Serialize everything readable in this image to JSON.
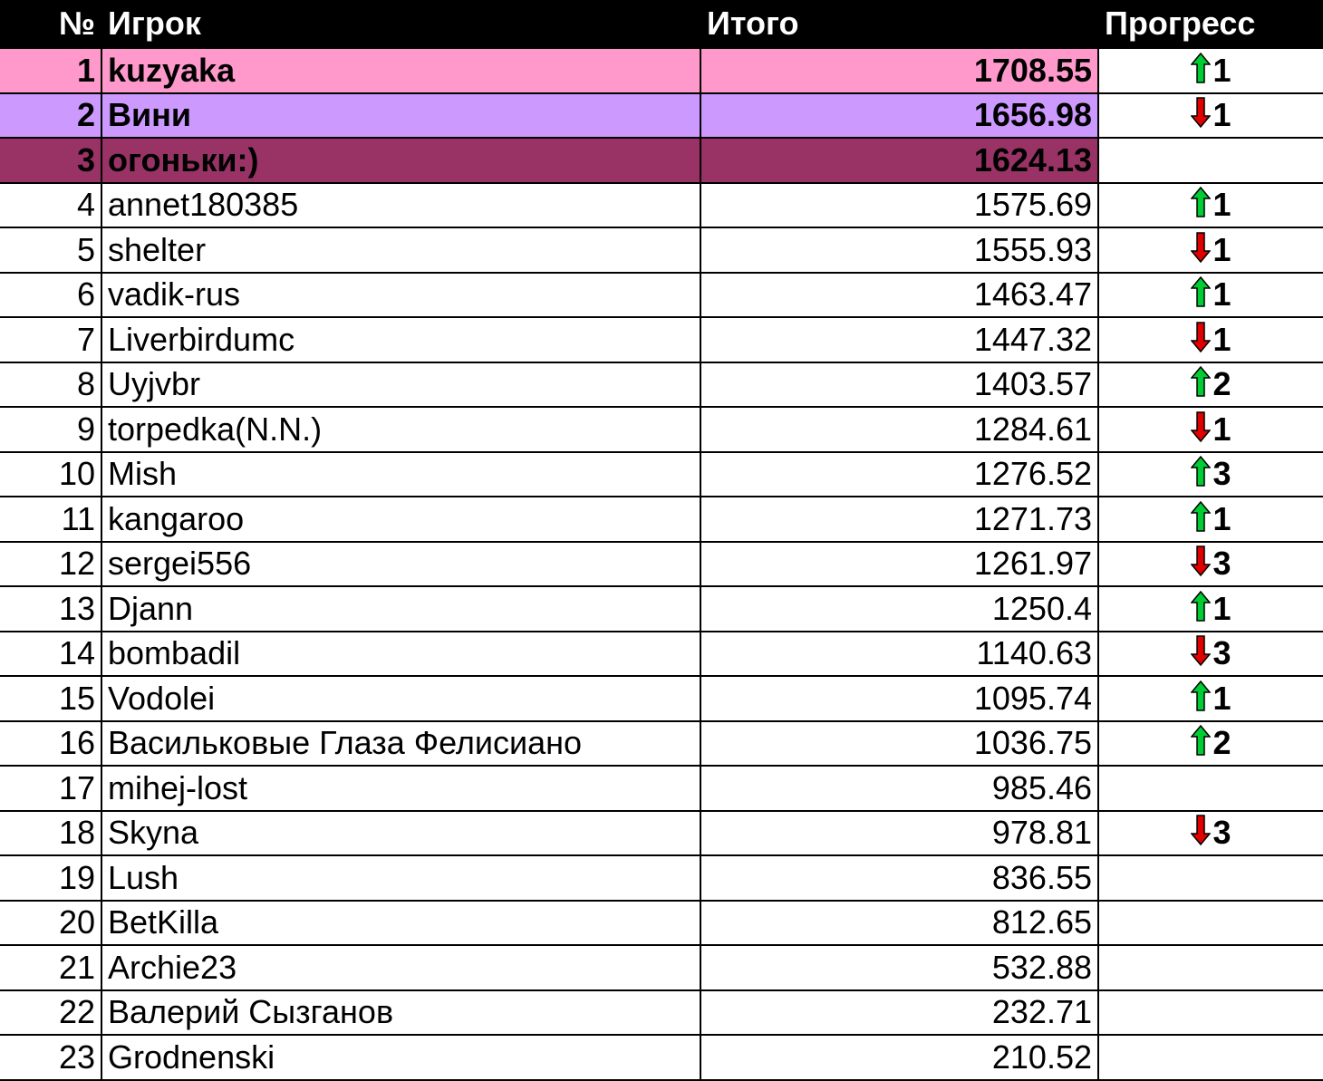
{
  "columns": [
    "№",
    "Игрок",
    "Итого",
    "Прогресс"
  ],
  "colors": {
    "header_bg": "#000000",
    "rank1_bg": "#ff99cc",
    "rank2_bg": "#cc99ff",
    "rank3_bg": "#993366",
    "arrow_up": "#00cc33",
    "arrow_down": "#e00000"
  },
  "rows": [
    {
      "rank": "1",
      "player": "kuzyaka",
      "total": "1708.55",
      "dir": "up",
      "delta": "1"
    },
    {
      "rank": "2",
      "player": "Вини",
      "total": "1656.98",
      "dir": "down",
      "delta": "1"
    },
    {
      "rank": "3",
      "player": "огоньки:)",
      "total": "1624.13",
      "dir": "",
      "delta": ""
    },
    {
      "rank": "4",
      "player": "annet180385",
      "total": "1575.69",
      "dir": "up",
      "delta": "1"
    },
    {
      "rank": "5",
      "player": "shelter",
      "total": "1555.93",
      "dir": "down",
      "delta": "1"
    },
    {
      "rank": "6",
      "player": "vadik-rus",
      "total": "1463.47",
      "dir": "up",
      "delta": "1"
    },
    {
      "rank": "7",
      "player": "Liverbirdumc",
      "total": "1447.32",
      "dir": "down",
      "delta": "1"
    },
    {
      "rank": "8",
      "player": "Uyjvbr",
      "total": "1403.57",
      "dir": "up",
      "delta": "2"
    },
    {
      "rank": "9",
      "player": "torpedka(N.N.)",
      "total": "1284.61",
      "dir": "down",
      "delta": "1"
    },
    {
      "rank": "10",
      "player": "Mish",
      "total": "1276.52",
      "dir": "up",
      "delta": "3"
    },
    {
      "rank": "11",
      "player": "kangaroo",
      "total": "1271.73",
      "dir": "up",
      "delta": "1"
    },
    {
      "rank": "12",
      "player": "sergei556",
      "total": "1261.97",
      "dir": "down",
      "delta": "3"
    },
    {
      "rank": "13",
      "player": "Djann",
      "total": "1250.4",
      "dir": "up",
      "delta": "1"
    },
    {
      "rank": "14",
      "player": "bombadil",
      "total": "1140.63",
      "dir": "down",
      "delta": "3"
    },
    {
      "rank": "15",
      "player": "Vodolei",
      "total": "1095.74",
      "dir": "up",
      "delta": "1"
    },
    {
      "rank": "16",
      "player": "Васильковые Глаза Фелисиано",
      "total": "1036.75",
      "dir": "up",
      "delta": "2"
    },
    {
      "rank": "17",
      "player": "mihej-lost",
      "total": "985.46",
      "dir": "",
      "delta": ""
    },
    {
      "rank": "18",
      "player": "Skyna",
      "total": "978.81",
      "dir": "down",
      "delta": "3"
    },
    {
      "rank": "19",
      "player": "Lush",
      "total": "836.55",
      "dir": "",
      "delta": ""
    },
    {
      "rank": "20",
      "player": "BetKilla",
      "total": "812.65",
      "dir": "",
      "delta": ""
    },
    {
      "rank": "21",
      "player": "Archie23",
      "total": "532.88",
      "dir": "",
      "delta": ""
    },
    {
      "rank": "22",
      "player": "Валерий Сызганов",
      "total": "232.71",
      "dir": "",
      "delta": ""
    },
    {
      "rank": "23",
      "player": "Grodnenski",
      "total": "210.52",
      "dir": "",
      "delta": ""
    }
  ]
}
